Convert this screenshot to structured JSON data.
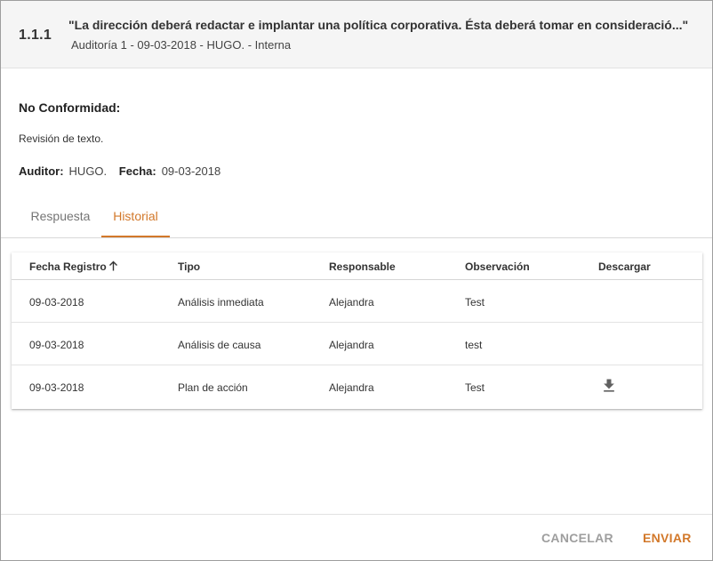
{
  "header": {
    "code": "1.1.1",
    "title": "\"La dirección deberá redactar e implantar una política corporativa. Ésta deberá tomar en consideració...\"",
    "subtitle": "Auditoría 1 - 09-03-2018 - HUGO. - Interna"
  },
  "nonconformity": {
    "label": "No Conformidad:",
    "text": "Revisión de texto."
  },
  "meta": {
    "auditor_label": "Auditor:",
    "auditor_value": "HUGO.",
    "date_label": "Fecha:",
    "date_value": "09-03-2018"
  },
  "tabs": [
    {
      "label": "Respuesta",
      "active": false
    },
    {
      "label": "Historial",
      "active": true
    }
  ],
  "table": {
    "columns": [
      "Fecha Registro",
      "Tipo",
      "Responsable",
      "Observación",
      "Descargar"
    ],
    "sort_icon": "arrow-up-icon",
    "rows": [
      {
        "fecha": "09-03-2018",
        "tipo": "Análisis inmediata",
        "responsable": "Alejandra",
        "observacion": "Test",
        "download": false
      },
      {
        "fecha": "09-03-2018",
        "tipo": "Análisis de causa",
        "responsable": "Alejandra",
        "observacion": "test",
        "download": false
      },
      {
        "fecha": "09-03-2018",
        "tipo": "Plan de acción",
        "responsable": "Alejandra",
        "observacion": "Test",
        "download": true
      }
    ]
  },
  "footer": {
    "cancel_label": "CANCELAR",
    "send_label": "ENVIAR"
  },
  "colors": {
    "accent": "#d2782a",
    "header_bg": "#f5f5f5",
    "muted_button": "#9e9e9e"
  }
}
